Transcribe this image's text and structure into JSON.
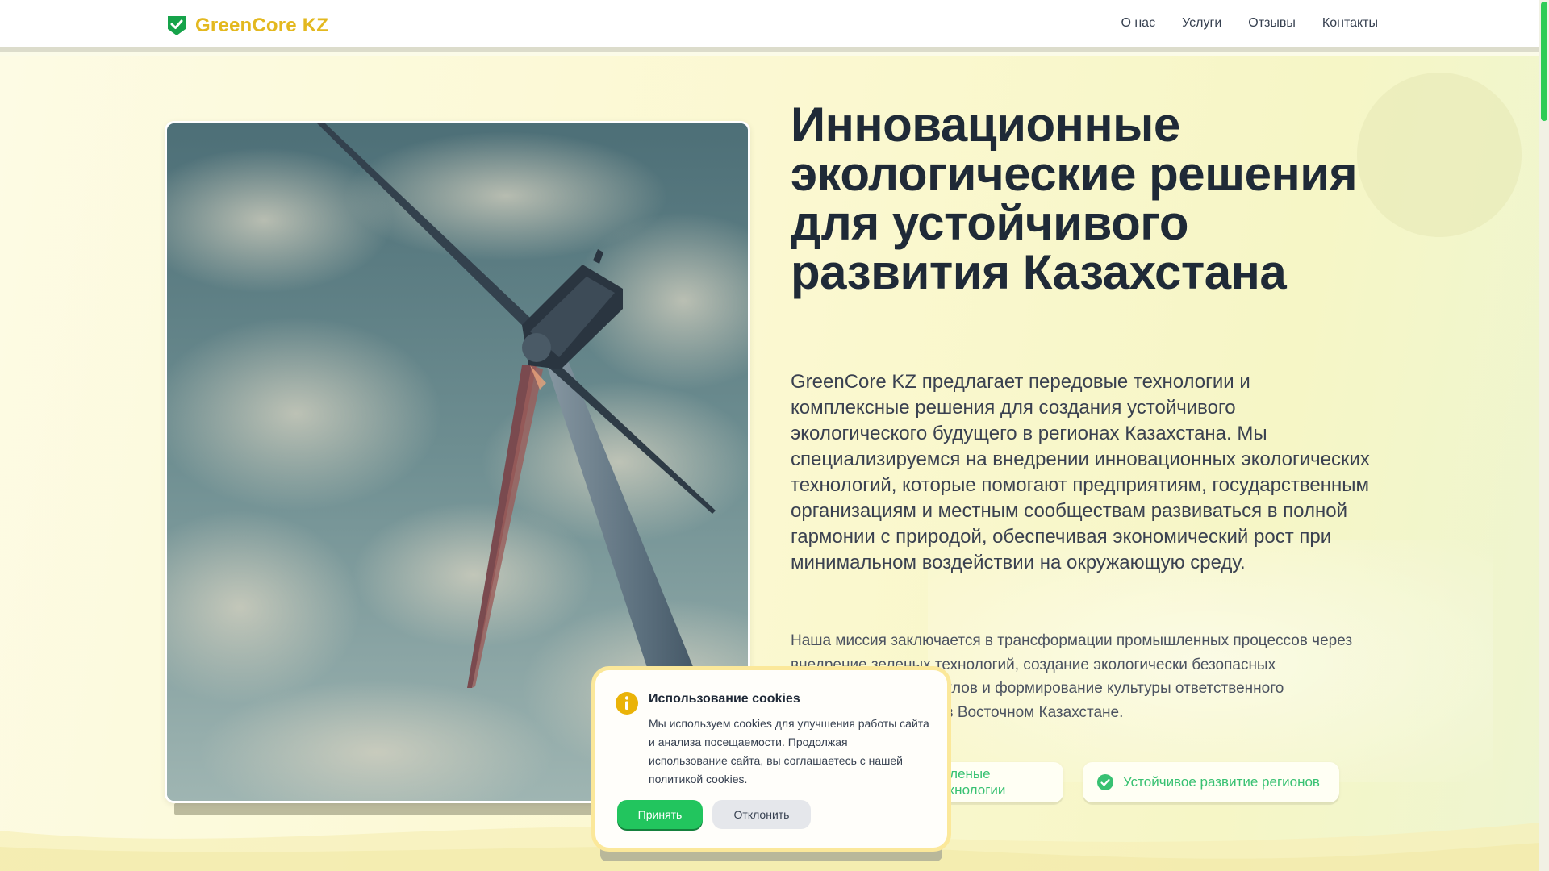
{
  "header": {
    "brand": "GreenCore KZ",
    "brand_icon": "shield-check-icon",
    "nav": [
      "О нас",
      "Услуги",
      "Отзывы",
      "Контакты"
    ]
  },
  "hero": {
    "image_alt": "wind-turbine-photo",
    "headline": "Инновационные экологические решения для устойчивого развития Казахстана",
    "lead": "GreenCore KZ предлагает передовые технологии и комплексные решения для создания устойчивого экологического будущего в регионах Казахстана. Мы специализируемся на внедрении инновационных экологических технологий, которые помогают предприятиям, государственным организациям и местным сообществам развиваться в полной гармонии с природой, обеспечивая экономический рост при минимальном воздействии на окружающую среду.",
    "mission": "Наша миссия заключается в трансформации промышленных процессов через внедрение зеленых технологий, создание экологически безопасных производственных циклов и формирование культуры ответственного природопользования в Восточном Казахстане.",
    "chips": [
      "Зеленые технологии",
      "Устойчивое развитие регионов"
    ]
  },
  "cookie": {
    "icon": "info-icon",
    "title": "Использование cookies",
    "text": "Мы используем cookies для улучшения работы сайта и анализа посещаемости. Продолжая использование сайта, вы соглашаетесь с нашей политикой cookies.",
    "accept_label": "Принять",
    "decline_label": "Отклонить"
  },
  "colors": {
    "brand": "#e3b81f",
    "accent_green": "#22c55e",
    "chip_text": "#38c172",
    "cookie_border": "#fbe89a",
    "background": "#fbf8d0"
  }
}
